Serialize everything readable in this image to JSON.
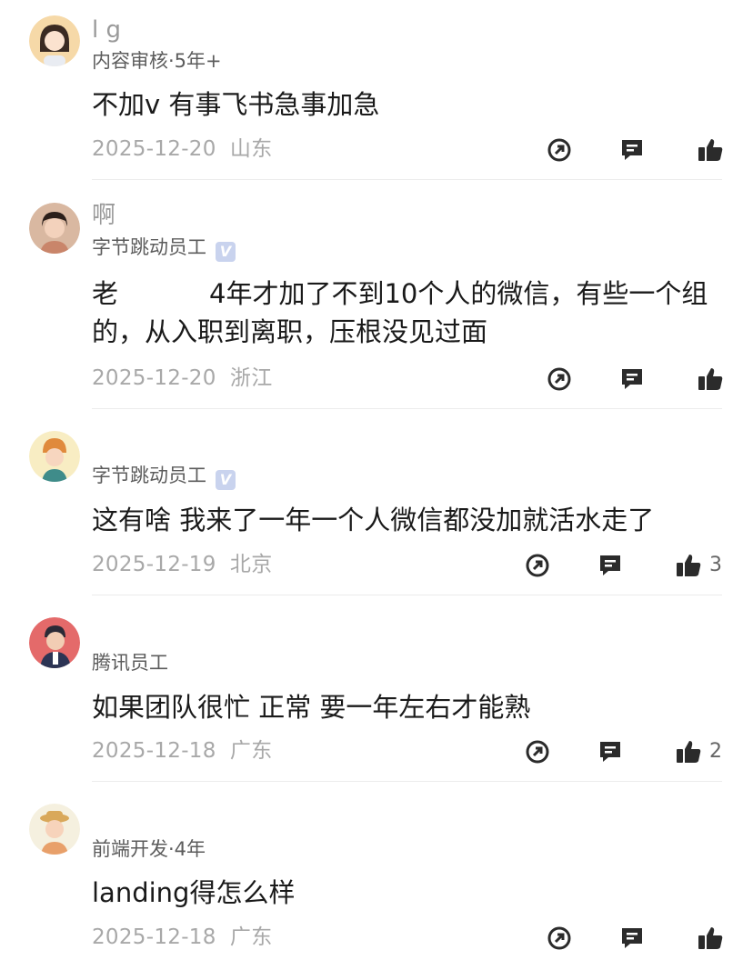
{
  "comments": [
    {
      "name": "l   g",
      "meta": "内容审核·5年+",
      "verified": false,
      "text": "不加v  有事飞书急事加急",
      "date": "2025-12-20",
      "location": "山东",
      "likes": ""
    },
    {
      "name": "啊",
      "meta": "字节跳动员工",
      "verified": true,
      "text_prefix": "老",
      "text": "4年才加了不到10个人的微信，有些一个组的，从入职到离职，压根没见过面",
      "date": "2025-12-20",
      "location": "浙江",
      "likes": ""
    },
    {
      "name": "",
      "meta": "字节跳动员工",
      "verified": true,
      "text": "这有啥 我来了一年一个人微信都没加就活水走了",
      "date": "2025-12-19",
      "location": "北京",
      "likes": "3"
    },
    {
      "name": "",
      "meta": "腾讯员工",
      "verified": false,
      "text": "如果团队很忙 正常 要一年左右才能熟",
      "date": "2025-12-18",
      "location": "广东",
      "likes": "2"
    },
    {
      "name": "",
      "meta": "前端开发·4年",
      "verified": false,
      "text": "landing得怎么样",
      "date": "2025-12-18",
      "location": "广东",
      "likes": ""
    }
  ],
  "icons": {
    "share": "share-icon",
    "reply": "comment-icon",
    "like": "thumbs-up-icon"
  },
  "colors": {
    "text": "#1a1a1a",
    "meta": "#5c5c5c",
    "date": "#a8a8a8",
    "icon": "#2b2b2b",
    "badge": "#c9d3ee"
  }
}
